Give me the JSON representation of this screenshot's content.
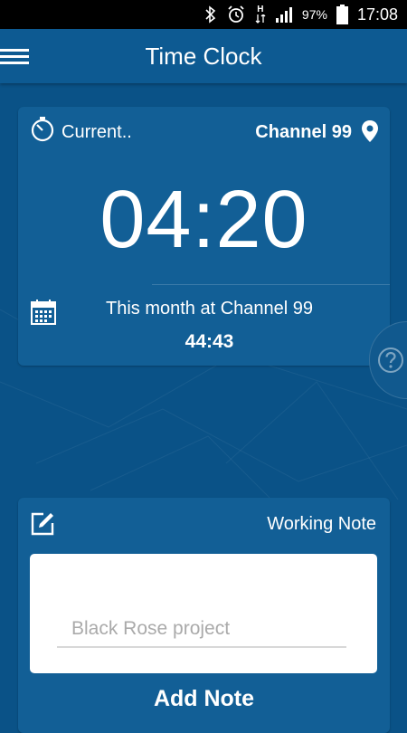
{
  "status_bar": {
    "icons": [
      "bluetooth-icon",
      "alarm-icon",
      "data-arrows-icon",
      "signal-icon",
      "battery-icon"
    ],
    "hspa": "H",
    "battery_percent": "97%",
    "time": "17:08"
  },
  "app_bar": {
    "title": "Time Clock",
    "menu_icon": "hamburger-menu-icon"
  },
  "current_card": {
    "current_label": "Current..",
    "channel": "Channel 99",
    "elapsed_time": "04:20",
    "month_label": "This month at Channel 99",
    "month_total": "44:43",
    "icons": [
      "timer-icon",
      "location-pin-icon",
      "calendar-icon"
    ]
  },
  "help": {
    "icon": "help-icon"
  },
  "note_card": {
    "label": "Working Note",
    "placeholder": "Black Rose project",
    "value": "",
    "add_button": "Add Note",
    "icon": "edit-note-icon"
  },
  "colors": {
    "background": "#0a5287",
    "app_bar": "#0d5a92",
    "card": "#125f96",
    "text": "#ffffff"
  }
}
